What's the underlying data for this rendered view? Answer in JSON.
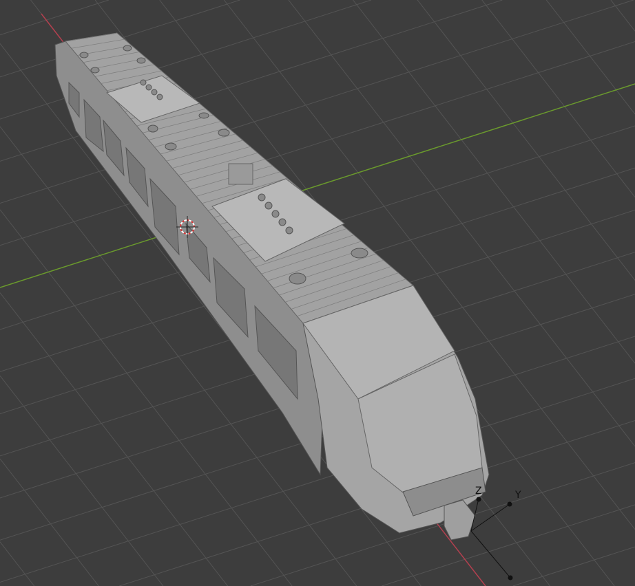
{
  "viewport": {
    "background": "#3d3d3d",
    "grid_color": "#545454",
    "x_axis_color": "#b3404f",
    "y_axis_color": "#6a9a2c",
    "object_color": "#a9a9a9",
    "gizmo_labels": {
      "z": "Z",
      "y": "Y"
    }
  }
}
